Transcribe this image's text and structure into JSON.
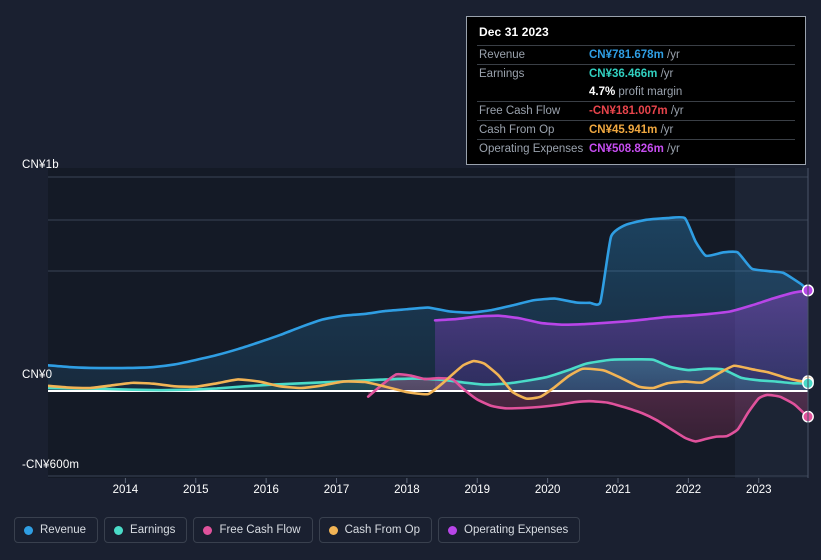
{
  "tooltip": {
    "title": "Dec 31 2023",
    "rows": [
      {
        "label": "Revenue",
        "value": "CN¥781.678m",
        "unit": " /yr",
        "color": "#2f9ee3"
      },
      {
        "label": "Earnings",
        "value": "CN¥36.466m",
        "unit": " /yr",
        "color": "#31d0c0"
      },
      {
        "label": "",
        "value": "4.7%",
        "unit": " profit margin",
        "color": "#ffffff"
      },
      {
        "label": "Free Cash Flow",
        "value": "-CN¥181.007m",
        "unit": " /yr",
        "color": "#e8444b"
      },
      {
        "label": "Cash From Op",
        "value": "CN¥45.941m",
        "unit": " /yr",
        "color": "#f0a840"
      },
      {
        "label": "Operating Expenses",
        "value": "CN¥508.826m",
        "unit": " /yr",
        "color": "#c64df0"
      }
    ]
  },
  "axes": {
    "y_labels": [
      "CN¥1b",
      "CN¥0",
      "-CN¥600m"
    ],
    "x_labels": [
      "2014",
      "2015",
      "2016",
      "2017",
      "2018",
      "2019",
      "2020",
      "2021",
      "2022",
      "2023"
    ],
    "y_max_value": 1000,
    "y_min_value": -600,
    "y_unit": "CN¥ millions"
  },
  "legend": [
    {
      "label": "Revenue",
      "color": "#2f9ee3"
    },
    {
      "label": "Earnings",
      "color": "#4adbc8"
    },
    {
      "label": "Free Cash Flow",
      "color": "#e0529c"
    },
    {
      "label": "Cash From Op",
      "color": "#f2b455"
    },
    {
      "label": "Operating Expenses",
      "color": "#b845e8"
    }
  ],
  "chart_data": {
    "type": "line",
    "title": "",
    "xlabel": "",
    "ylabel": "CN¥",
    "ylim": [
      -600,
      1000
    ],
    "xlim": [
      "2013.4",
      "2024.2"
    ],
    "grid": true,
    "legend_position": "bottom",
    "gridlines_y": [
      1000,
      800,
      560,
      0,
      -600
    ],
    "zero_line": 0,
    "highlight_band_start_x": "2023.1",
    "series": [
      {
        "name": "Revenue",
        "color": "#2f9ee3",
        "filled": true,
        "points": [
          [
            2013.4,
            120
          ],
          [
            2013.7,
            112
          ],
          [
            2014.0,
            108
          ],
          [
            2014.3,
            107
          ],
          [
            2014.6,
            108
          ],
          [
            2014.9,
            112
          ],
          [
            2015.2,
            124
          ],
          [
            2015.5,
            145
          ],
          [
            2015.8,
            168
          ],
          [
            2016.1,
            196
          ],
          [
            2016.4,
            228
          ],
          [
            2016.7,
            262
          ],
          [
            2017.0,
            300
          ],
          [
            2017.3,
            334
          ],
          [
            2017.6,
            352
          ],
          [
            2017.9,
            360
          ],
          [
            2018.2,
            374
          ],
          [
            2018.5,
            382
          ],
          [
            2018.8,
            390
          ],
          [
            2019.1,
            372
          ],
          [
            2019.4,
            366
          ],
          [
            2019.7,
            378
          ],
          [
            2020.0,
            400
          ],
          [
            2020.3,
            424
          ],
          [
            2020.6,
            432
          ],
          [
            2020.9,
            414
          ],
          [
            2021.1,
            412
          ],
          [
            2021.25,
            416
          ],
          [
            2021.4,
            720
          ],
          [
            2021.6,
            775
          ],
          [
            2021.9,
            800
          ],
          [
            2022.2,
            808
          ],
          [
            2022.45,
            808
          ],
          [
            2022.6,
            700
          ],
          [
            2022.75,
            632
          ],
          [
            2023.0,
            648
          ],
          [
            2023.2,
            648
          ],
          [
            2023.4,
            572
          ],
          [
            2023.65,
            560
          ],
          [
            2023.85,
            552
          ],
          [
            2024.1,
            500
          ],
          [
            2024.2,
            470
          ]
        ]
      },
      {
        "name": "Operating Expenses",
        "color": "#b845e8",
        "filled": true,
        "points": [
          [
            2018.9,
            330
          ],
          [
            2019.2,
            336
          ],
          [
            2019.5,
            348
          ],
          [
            2019.8,
            352
          ],
          [
            2020.1,
            340
          ],
          [
            2020.4,
            318
          ],
          [
            2020.7,
            310
          ],
          [
            2021.0,
            312
          ],
          [
            2021.3,
            318
          ],
          [
            2021.6,
            325
          ],
          [
            2021.9,
            335
          ],
          [
            2022.2,
            346
          ],
          [
            2022.5,
            352
          ],
          [
            2022.8,
            360
          ],
          [
            2023.1,
            372
          ],
          [
            2023.4,
            400
          ],
          [
            2023.7,
            432
          ],
          [
            2024.0,
            460
          ],
          [
            2024.2,
            470
          ]
        ]
      },
      {
        "name": "Cash From Op",
        "color": "#f2b455",
        "filled": false,
        "points": [
          [
            2013.4,
            24
          ],
          [
            2013.7,
            16
          ],
          [
            2014.0,
            14
          ],
          [
            2014.3,
            26
          ],
          [
            2014.6,
            38
          ],
          [
            2014.9,
            34
          ],
          [
            2015.2,
            22
          ],
          [
            2015.5,
            20
          ],
          [
            2015.8,
            36
          ],
          [
            2016.1,
            54
          ],
          [
            2016.4,
            44
          ],
          [
            2016.7,
            22
          ],
          [
            2017.0,
            14
          ],
          [
            2017.3,
            26
          ],
          [
            2017.6,
            44
          ],
          [
            2017.9,
            42
          ],
          [
            2018.2,
            20
          ],
          [
            2018.5,
            -8
          ],
          [
            2018.8,
            -22
          ],
          [
            2019.0,
            34
          ],
          [
            2019.15,
            78
          ],
          [
            2019.3,
            120
          ],
          [
            2019.45,
            140
          ],
          [
            2019.6,
            128
          ],
          [
            2019.8,
            74
          ],
          [
            2020.0,
            -6
          ],
          [
            2020.2,
            -54
          ],
          [
            2020.4,
            -40
          ],
          [
            2020.6,
            18
          ],
          [
            2020.8,
            70
          ],
          [
            2021.0,
            104
          ],
          [
            2021.3,
            96
          ],
          [
            2021.55,
            60
          ],
          [
            2021.8,
            20
          ],
          [
            2022.0,
            14
          ],
          [
            2022.2,
            36
          ],
          [
            2022.45,
            44
          ],
          [
            2022.7,
            40
          ],
          [
            2022.95,
            86
          ],
          [
            2023.15,
            118
          ],
          [
            2023.4,
            102
          ],
          [
            2023.65,
            86
          ],
          [
            2023.9,
            60
          ],
          [
            2024.1,
            46
          ],
          [
            2024.2,
            46
          ]
        ]
      },
      {
        "name": "Earnings",
        "color": "#4adbc8",
        "filled": true,
        "points": [
          [
            2013.4,
            14
          ],
          [
            2013.8,
            12
          ],
          [
            2014.2,
            10
          ],
          [
            2014.6,
            6
          ],
          [
            2015.0,
            4
          ],
          [
            2015.4,
            6
          ],
          [
            2015.8,
            12
          ],
          [
            2016.2,
            22
          ],
          [
            2016.6,
            30
          ],
          [
            2017.0,
            36
          ],
          [
            2017.4,
            42
          ],
          [
            2017.8,
            48
          ],
          [
            2018.2,
            54
          ],
          [
            2018.6,
            58
          ],
          [
            2019.0,
            52
          ],
          [
            2019.3,
            40
          ],
          [
            2019.6,
            30
          ],
          [
            2019.9,
            34
          ],
          [
            2020.2,
            48
          ],
          [
            2020.5,
            66
          ],
          [
            2020.8,
            98
          ],
          [
            2021.05,
            128
          ],
          [
            2021.4,
            146
          ],
          [
            2021.75,
            148
          ],
          [
            2022.0,
            146
          ],
          [
            2022.25,
            112
          ],
          [
            2022.5,
            98
          ],
          [
            2022.75,
            104
          ],
          [
            2023.0,
            100
          ],
          [
            2023.25,
            62
          ],
          [
            2023.5,
            50
          ],
          [
            2023.75,
            44
          ],
          [
            2024.0,
            36
          ],
          [
            2024.2,
            36
          ]
        ]
      },
      {
        "name": "Free Cash Flow",
        "color": "#e0529c",
        "filled": true,
        "points": [
          [
            2017.95,
            -40
          ],
          [
            2018.15,
            30
          ],
          [
            2018.35,
            78
          ],
          [
            2018.55,
            72
          ],
          [
            2018.75,
            56
          ],
          [
            2018.95,
            60
          ],
          [
            2019.15,
            54
          ],
          [
            2019.3,
            10
          ],
          [
            2019.5,
            -60
          ],
          [
            2019.7,
            -105
          ],
          [
            2019.9,
            -122
          ],
          [
            2020.15,
            -120
          ],
          [
            2020.4,
            -112
          ],
          [
            2020.65,
            -98
          ],
          [
            2020.9,
            -78
          ],
          [
            2021.1,
            -72
          ],
          [
            2021.35,
            -82
          ],
          [
            2021.6,
            -116
          ],
          [
            2021.85,
            -158
          ],
          [
            2022.05,
            -206
          ],
          [
            2022.25,
            -268
          ],
          [
            2022.45,
            -330
          ],
          [
            2022.6,
            -356
          ],
          [
            2022.75,
            -338
          ],
          [
            2022.9,
            -322
          ],
          [
            2023.05,
            -318
          ],
          [
            2023.2,
            -272
          ],
          [
            2023.35,
            -152
          ],
          [
            2023.5,
            -52
          ],
          [
            2023.62,
            -28
          ],
          [
            2023.8,
            -40
          ],
          [
            2024.0,
            -92
          ],
          [
            2024.15,
            -160
          ],
          [
            2024.2,
            -181
          ]
        ]
      }
    ],
    "end_markers": [
      {
        "series": "Revenue",
        "color": "#2f9ee3"
      },
      {
        "series": "Operating Expenses",
        "color": "#b845e8"
      },
      {
        "series": "Cash From Op",
        "color": "#f2b455"
      },
      {
        "series": "Earnings",
        "color": "#4adbc8"
      },
      {
        "series": "Free Cash Flow",
        "color": "#e0529c"
      }
    ]
  }
}
